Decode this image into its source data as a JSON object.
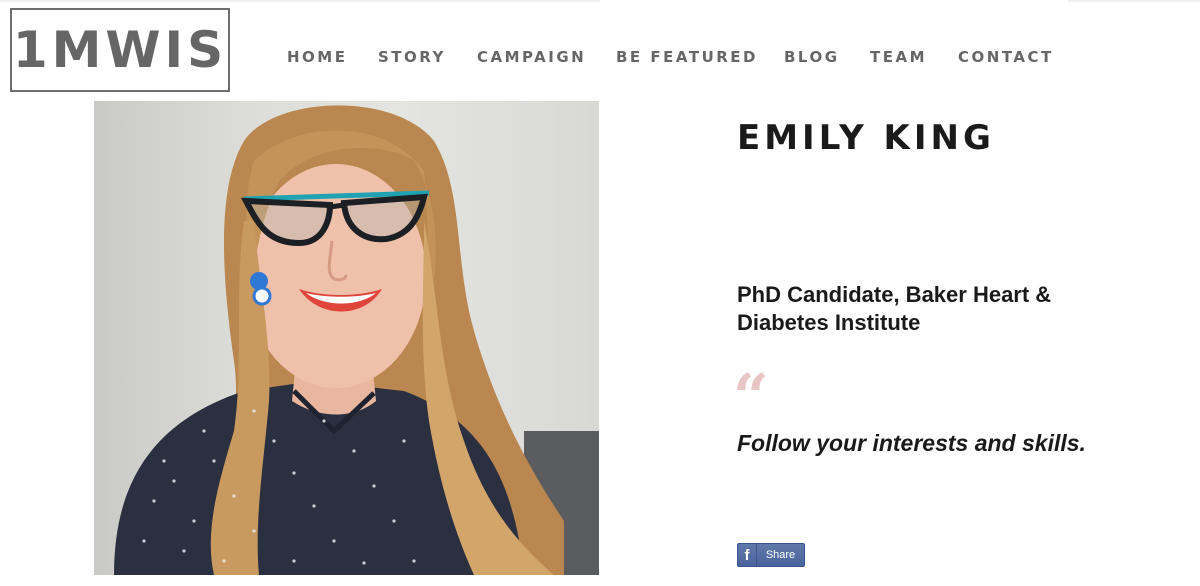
{
  "brand": {
    "logo_text": "1MWIS"
  },
  "nav": {
    "items": [
      {
        "label": "HOME"
      },
      {
        "label": "STORY"
      },
      {
        "label": "CAMPAIGN"
      },
      {
        "label": "BE FEATURED"
      },
      {
        "label": "BLOG"
      },
      {
        "label": "TEAM"
      },
      {
        "label": "CONTACT"
      }
    ]
  },
  "profile": {
    "name": "EMILY KING",
    "role": "PhD Candidate, Baker Heart & Diabetes Institute",
    "quote_mark": "“",
    "quote": "Follow your interests and skills."
  },
  "share": {
    "icon": "facebook-icon",
    "icon_glyph": "f",
    "label": "Share"
  },
  "colors": {
    "nav_text": "#666666",
    "heading_text": "#1a1a1a",
    "quote_mark": "#e8c4c4",
    "facebook_blue": "#4a649b"
  }
}
